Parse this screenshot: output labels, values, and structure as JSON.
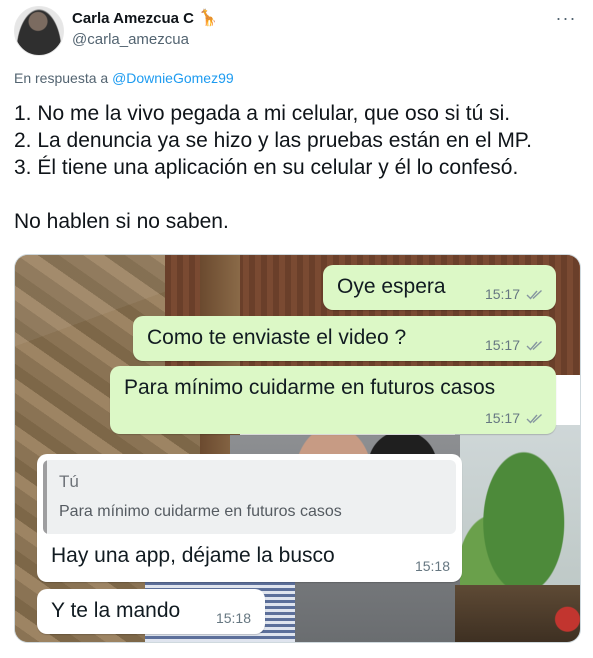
{
  "author": {
    "display_name": "Carla Amezcua C",
    "emoji": "🦒",
    "handle": "@carla_amezcua"
  },
  "more_options": "···",
  "reply_context": {
    "prefix": "En respuesta a ",
    "mention": "@DownieGomez99"
  },
  "tweet_lines": [
    "1. No me la vivo pegada a mi celular, que oso si tú si.",
    "2. La denuncia ya se hizo y las pruebas están en el MP.",
    "3. Él tiene una aplicación en su celular y él lo confesó.",
    "No hablen si no saben."
  ],
  "chat": {
    "messages": [
      {
        "text": "Oye espera",
        "time": "15:17",
        "direction": "out"
      },
      {
        "text": "Como te enviaste el video ?",
        "time": "15:17",
        "direction": "out"
      },
      {
        "text": "Para mínimo cuidarme en futuros casos",
        "time": "15:17",
        "direction": "out"
      },
      {
        "text": "Hay una app, déjame la busco",
        "time": "15:18",
        "direction": "in",
        "quote": {
          "author": "Tú",
          "text": "Para mínimo cuidarme en futuros casos"
        }
      },
      {
        "text": "Y te la mando",
        "time": "15:18",
        "direction": "in"
      }
    ],
    "colors": {
      "outgoing_bubble": "#dcf8c6",
      "incoming_bubble": "#ffffff",
      "mention": "#1d9bf0"
    }
  }
}
